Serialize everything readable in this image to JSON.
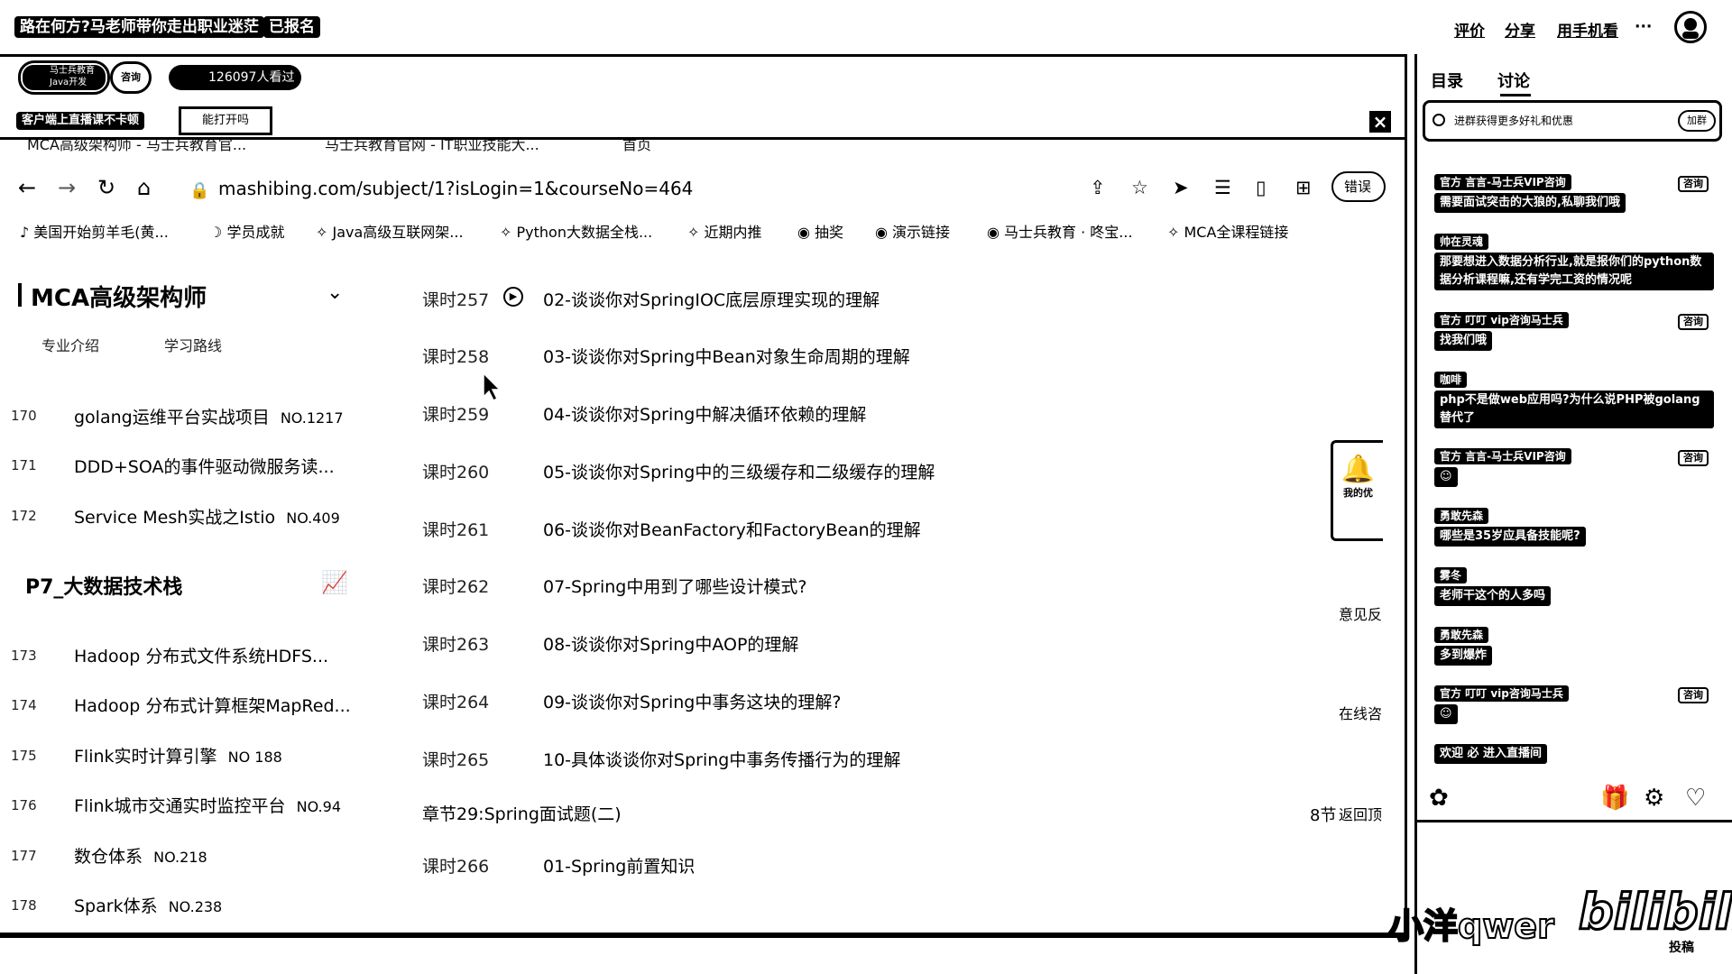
{
  "top": {
    "title": "路在何方?马老师带你走出职业迷茫",
    "enrolled": "已报名",
    "actions": [
      "评价",
      "分享",
      "用手机看",
      "···"
    ]
  },
  "player": {
    "logo_text": "马士兵教育",
    "logo_sub": "Java开发",
    "consult": "咨询",
    "viewers": "126097人看过",
    "no_flow": "客户端上直播课不卡顿",
    "no_flow_btn": "能打开吗",
    "close": "×"
  },
  "browser": {
    "tabs": [
      "MCA高级架构师 - 马士兵教育官...",
      "马士兵教育官网 - IT职业技能大...",
      "首页"
    ],
    "url": "mashibing.com/subject/1?isLogin=1&courseNo=464",
    "toolbar_label": "错误",
    "bookmarks": [
      "美国开始剪羊毛(黄...",
      "学员成就",
      "Java高级互联网架...",
      "Python大数据全栈...",
      "近期内推",
      "抽奖",
      "演示链接",
      "马士兵教育 · 咚宝...",
      "MCA全课程链接"
    ]
  },
  "course": {
    "title": "MCA高级架构师",
    "subtabs": [
      "专业介绍",
      "学习路线"
    ],
    "items_a": [
      {
        "n": "170",
        "title": "golang运维平台实战项目",
        "code": "NO.1217"
      },
      {
        "n": "171",
        "title": "DDD+SOA的事件驱动微服务读...",
        "code": ""
      },
      {
        "n": "172",
        "title": "Service Mesh实战之Istio",
        "code": "NO.409"
      }
    ],
    "section": "P7_大数据技术栈",
    "items_b": [
      {
        "n": "173",
        "title": "Hadoop 分布式文件系统HDFS...",
        "code": ""
      },
      {
        "n": "174",
        "title": "Hadoop 分布式计算框架MapRed...",
        "code": ""
      },
      {
        "n": "175",
        "title": "Flink实时计算引擎",
        "code": "NO 188"
      },
      {
        "n": "176",
        "title": "Flink城市交通实时监控平台",
        "code": "NO.94"
      },
      {
        "n": "177",
        "title": "数仓体系",
        "code": "NO.218"
      },
      {
        "n": "178",
        "title": "Spark体系",
        "code": "NO.238"
      }
    ]
  },
  "lessons": [
    {
      "k": "课时257",
      "t": "02-谈谈你对SpringIOC底层原理实现的理解"
    },
    {
      "k": "课时258",
      "t": "03-谈谈你对Spring中Bean对象生命周期的理解"
    },
    {
      "k": "课时259",
      "t": "04-谈谈你对Spring中解决循环依赖的理解"
    },
    {
      "k": "课时260",
      "t": "05-谈谈你对Spring中的三级缓存和二级缓存的理解"
    },
    {
      "k": "课时261",
      "t": "06-谈谈你对BeanFactory和FactoryBean的理解"
    },
    {
      "k": "课时262",
      "t": "07-Spring中用到了哪些设计模式?"
    },
    {
      "k": "课时263",
      "t": "08-谈谈你对Spring中AOP的理解"
    },
    {
      "k": "课时264",
      "t": "09-谈谈你对Spring中事务这块的理解?"
    },
    {
      "k": "课时265",
      "t": "10-具体谈谈你对Spring中事务传播行为的理解"
    }
  ],
  "chapter": {
    "title": "章节29:Spring面试题(二)",
    "count": "8节",
    "back_top": "返回顶"
  },
  "lesson_last": {
    "k": "课时266",
    "t": "01-Spring前置知识"
  },
  "side": {
    "feedback": "意见反",
    "online": "在线咨",
    "card": "我的优"
  },
  "panel": {
    "tabs": [
      "目录",
      "讨论"
    ],
    "promo": "进群获得更多好礼和优惠",
    "promo_btn": "加群",
    "messages": [
      {
        "name": "官方 言言-马士兵VIP咨询",
        "badge": "咨询",
        "text": "需要面试突击的大狼的,私聊我们哦"
      },
      {
        "name": "帅在灵魂",
        "badge": "",
        "text": "那要想进入数据分析行业,就是报你们的python数据分析课程嘛,还有学完工资的情况呢"
      },
      {
        "name": "官方 叮叮 vip咨询马士兵",
        "badge": "咨询",
        "text": "找我们哦"
      },
      {
        "name": "咖啡",
        "badge": "",
        "text": "php不是做web应用吗?为什么说PHP被golang替代了"
      },
      {
        "name": "官方 言言-马士兵VIP咨询",
        "badge": "咨询",
        "text": "☺"
      },
      {
        "name": "勇敢先森",
        "badge": "",
        "text": "哪些是35岁应具备技能呢?"
      },
      {
        "name": "雾冬",
        "badge": "",
        "text": "老师干这个的人多吗"
      },
      {
        "name": "勇敢先森",
        "badge": "",
        "text": "多到爆炸"
      },
      {
        "name": "官方 叮叮 vip咨询马士兵",
        "badge": "咨询",
        "text": "☺"
      }
    ],
    "welcome": "欢迎 必 进入直播间"
  },
  "watermark": {
    "user": "小洋qwer",
    "logo": "bilibili",
    "sub": "投稿"
  }
}
